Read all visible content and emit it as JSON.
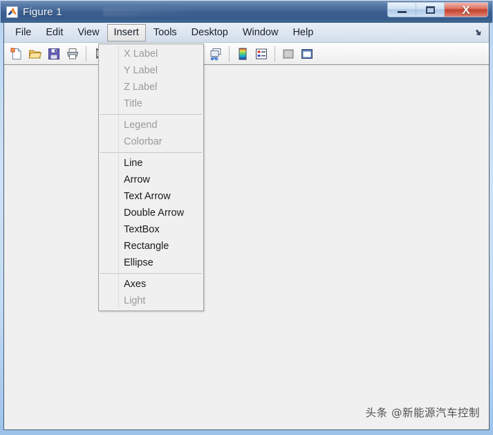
{
  "window": {
    "title": "Figure 1",
    "app_icon": "matlab-icon",
    "controls": {
      "minimize": "minimize-button",
      "maximize": "maximize-button",
      "close": "close-button",
      "close_glyph": "X"
    }
  },
  "menubar": {
    "items": [
      {
        "label": "File",
        "active": false
      },
      {
        "label": "Edit",
        "active": false
      },
      {
        "label": "View",
        "active": false
      },
      {
        "label": "Insert",
        "active": true
      },
      {
        "label": "Tools",
        "active": false
      },
      {
        "label": "Desktop",
        "active": false
      },
      {
        "label": "Window",
        "active": false
      },
      {
        "label": "Help",
        "active": false
      }
    ],
    "undock_icon": "undock-arrow-icon"
  },
  "toolbar": {
    "buttons": [
      {
        "name": "new-figure-icon",
        "tooltip": "New Figure"
      },
      {
        "name": "open-file-icon",
        "tooltip": "Open File"
      },
      {
        "name": "save-figure-icon",
        "tooltip": "Save Figure"
      },
      {
        "name": "print-figure-icon",
        "tooltip": "Print Figure"
      },
      {
        "name": "pointer-cursor-icon",
        "tooltip": "Edit Plot"
      },
      {
        "name": "brush-icon",
        "tooltip": "Brush/Select Data"
      },
      {
        "name": "brush-dropdown-icon",
        "tooltip": "Brush Options"
      },
      {
        "name": "link-data-icon",
        "tooltip": "Link Plot"
      },
      {
        "name": "colorbar-icon",
        "tooltip": "Insert Colorbar"
      },
      {
        "name": "legend-icon",
        "tooltip": "Insert Legend"
      },
      {
        "name": "hide-plot-tools-icon",
        "tooltip": "Hide Plot Tools"
      },
      {
        "name": "show-plot-tools-icon",
        "tooltip": "Show Plot Tools and Dock Figure"
      }
    ]
  },
  "insert_menu": {
    "open": true,
    "groups": [
      {
        "items": [
          {
            "label": "X Label",
            "enabled": false
          },
          {
            "label": "Y Label",
            "enabled": false
          },
          {
            "label": "Z Label",
            "enabled": false
          },
          {
            "label": "Title",
            "enabled": false
          }
        ]
      },
      {
        "items": [
          {
            "label": "Legend",
            "enabled": false
          },
          {
            "label": "Colorbar",
            "enabled": false
          }
        ]
      },
      {
        "items": [
          {
            "label": "Line",
            "enabled": true
          },
          {
            "label": "Arrow",
            "enabled": true
          },
          {
            "label": "Text Arrow",
            "enabled": true
          },
          {
            "label": "Double Arrow",
            "enabled": true
          },
          {
            "label": "TextBox",
            "enabled": true
          },
          {
            "label": "Rectangle",
            "enabled": true
          },
          {
            "label": "Ellipse",
            "enabled": true
          }
        ]
      },
      {
        "items": [
          {
            "label": "Axes",
            "enabled": true
          },
          {
            "label": "Light",
            "enabled": false
          }
        ]
      }
    ]
  },
  "canvas": {
    "watermark": "头条 @新能源汽车控制",
    "background_color": "#f0f0f0"
  },
  "colors": {
    "titlebar_blue": "#3b5f90",
    "frame_blue": "#bcd6f2",
    "close_red": "#c43d2a",
    "canvas_gray": "#f0f0f0",
    "menu_gray": "#f0f0f0",
    "disabled_text": "#9a9a9a"
  }
}
